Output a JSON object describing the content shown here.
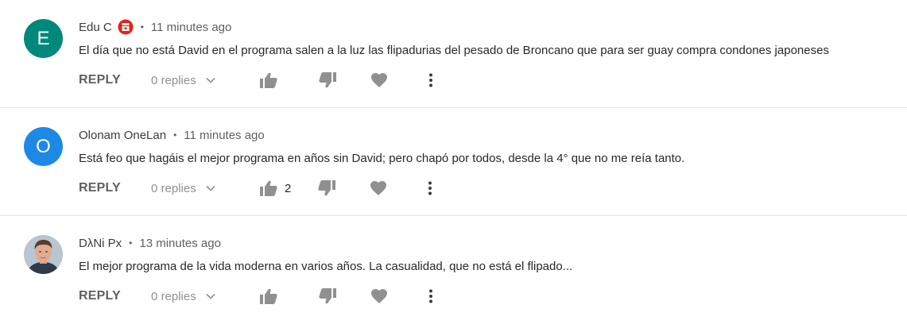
{
  "comments": [
    {
      "author": "Edu C",
      "has_badge": true,
      "avatar_letter": "E",
      "avatar_color": "#00897b",
      "time": "11 minutes ago",
      "text": "El día que no está David en el programa salen a la luz las flipadurias del pesado de Broncano que para ser guay compra condones japoneses",
      "reply_label": "REPLY",
      "replies_label": "0 replies",
      "like_count": ""
    },
    {
      "author": "Olonam OneLan",
      "has_badge": false,
      "avatar_letter": "O",
      "avatar_color": "#1e88e5",
      "time": "11 minutes ago",
      "text": "Está feo que hagáis el mejor programa en años sin David; pero chapó por todos, desde la 4° que no me reía tanto.",
      "reply_label": "REPLY",
      "replies_label": "0 replies",
      "like_count": "2"
    },
    {
      "author": "DλNi Px",
      "has_badge": false,
      "avatar_letter": "",
      "avatar_color": "#8a6a5a",
      "time": "13 minutes ago",
      "text": "El mejor programa de la vida moderna en varios años. La casualidad, que no está el flipado...",
      "reply_label": "REPLY",
      "replies_label": "0 replies",
      "like_count": ""
    }
  ],
  "separator": "•",
  "icons": {
    "badge": "sponsor-badge-icon",
    "chevron": "chevron-down-icon",
    "like": "thumbs-up-icon",
    "dislike": "thumbs-down-icon",
    "heart": "heart-icon",
    "more": "more-vert-icon"
  },
  "colors": {
    "icon_gray": "#909090",
    "badge_red": "#e62117"
  }
}
